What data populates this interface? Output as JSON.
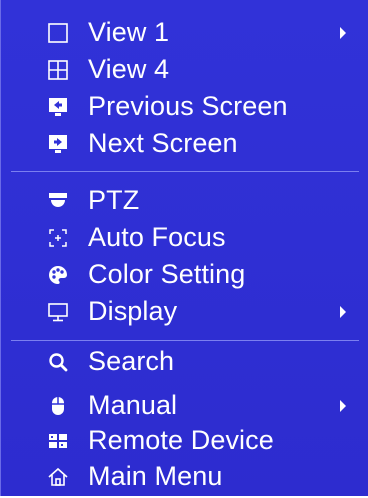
{
  "menu": {
    "items": [
      {
        "label": "View 1",
        "icon": "square-outline-icon",
        "submenu": true
      },
      {
        "label": "View 4",
        "icon": "quad-grid-icon",
        "submenu": false
      },
      {
        "label": "Previous Screen",
        "icon": "previous-screen-icon",
        "submenu": false
      },
      {
        "label": "Next Screen",
        "icon": "next-screen-icon",
        "submenu": false
      },
      {
        "label": "PTZ",
        "icon": "ptz-dome-icon",
        "submenu": false
      },
      {
        "label": "Auto Focus",
        "icon": "auto-focus-icon",
        "submenu": false
      },
      {
        "label": "Color Setting",
        "icon": "palette-icon",
        "submenu": false
      },
      {
        "label": "Display",
        "icon": "monitor-icon",
        "submenu": true
      },
      {
        "label": "Search",
        "icon": "search-icon",
        "submenu": false
      },
      {
        "label": "Manual",
        "icon": "mouse-icon",
        "submenu": true
      },
      {
        "label": "Remote Device",
        "icon": "remote-device-icon",
        "submenu": false
      },
      {
        "label": "Main Menu",
        "icon": "home-icon",
        "submenu": false
      }
    ]
  },
  "colors": {
    "background": "#3132d8",
    "text": "#ffffff",
    "separator": "#7b7ff0"
  }
}
